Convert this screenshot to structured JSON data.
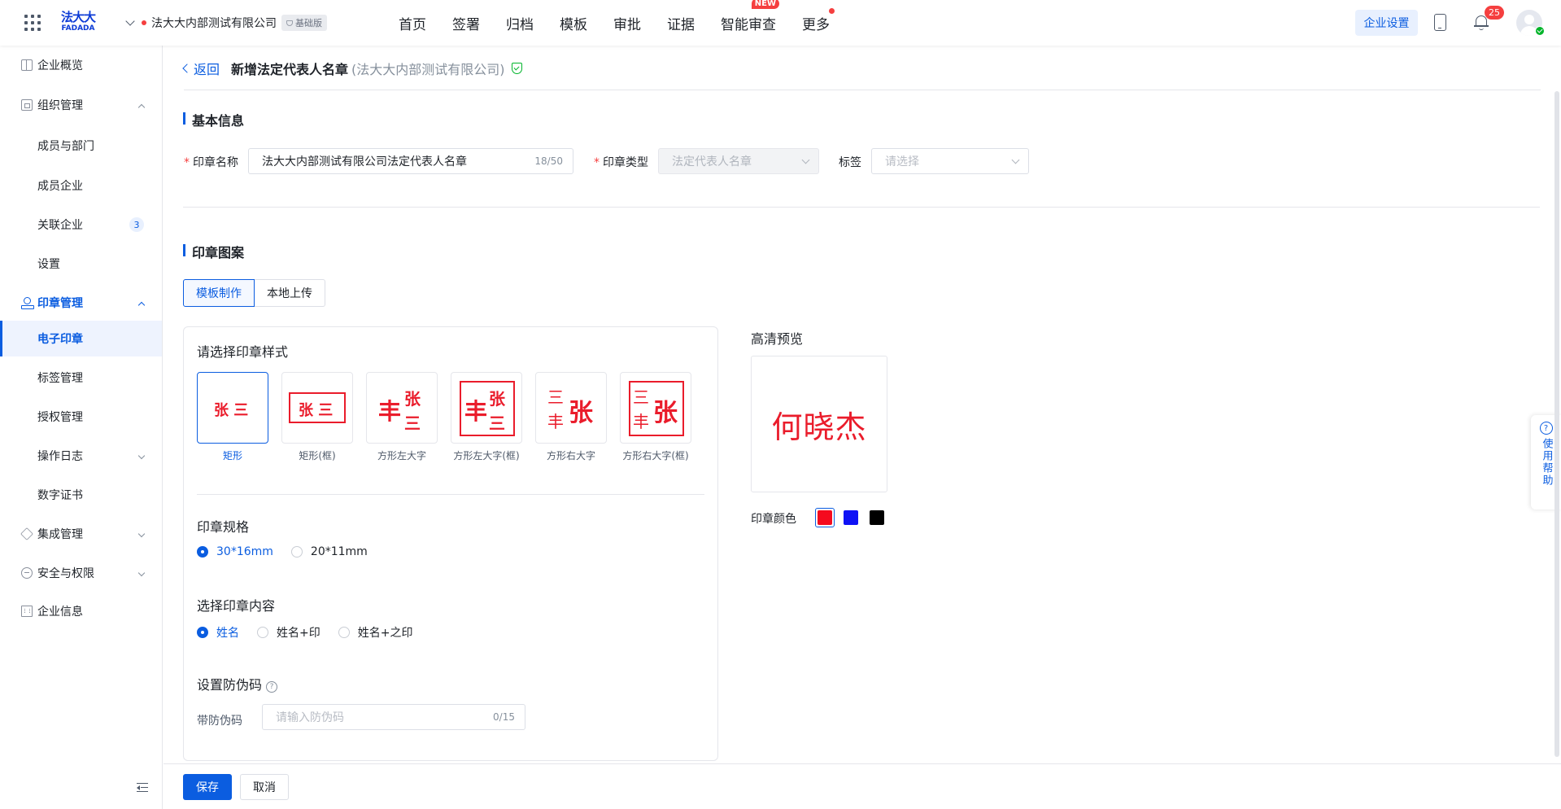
{
  "topbar": {
    "logo_cn": "法大大",
    "logo_en": "FADADA",
    "company_name": "法大大内部测试有限公司",
    "edition": "基础版",
    "nav": [
      {
        "label": "首页"
      },
      {
        "label": "签署"
      },
      {
        "label": "归档"
      },
      {
        "label": "模板"
      },
      {
        "label": "审批"
      },
      {
        "label": "证据"
      },
      {
        "label": "智能审查",
        "badge": "NEW"
      },
      {
        "label": "更多",
        "dot": true
      }
    ],
    "corp_settings": "企业设置",
    "notification_count": "25"
  },
  "sidebar": {
    "items": [
      {
        "label": "企业概览",
        "icon": "grid-icon"
      },
      {
        "label": "组织管理",
        "icon": "org-icon",
        "expanded": true
      },
      {
        "label": "成员与部门"
      },
      {
        "label": "成员企业"
      },
      {
        "label": "关联企业",
        "badge": "3"
      },
      {
        "label": "设置"
      },
      {
        "label": "印章管理",
        "icon": "seal-icon",
        "expanded": true
      },
      {
        "label": "电子印章",
        "active": true
      },
      {
        "label": "标签管理"
      },
      {
        "label": "授权管理"
      },
      {
        "label": "操作日志",
        "expandable": true
      },
      {
        "label": "数字证书"
      },
      {
        "label": "集成管理",
        "icon": "layers-icon",
        "expandable": true
      },
      {
        "label": "安全与权限",
        "icon": "shield-icon",
        "expandable": true
      },
      {
        "label": "企业信息",
        "icon": "building-icon"
      }
    ]
  },
  "page": {
    "back": "返回",
    "title": "新增法定代表人名章",
    "subtitle": "(法大大内部测试有限公司)"
  },
  "basic_info": {
    "section_title": "基本信息",
    "seal_name_label": "印章名称",
    "seal_name_value": "法大大内部测试有限公司法定代表人名章",
    "seal_name_count": "18/50",
    "seal_type_label": "印章类型",
    "seal_type_value": "法定代表人名章",
    "tag_label": "标签",
    "tag_placeholder": "请选择"
  },
  "seal_design": {
    "section_title": "印章图案",
    "tabs": [
      "模板制作",
      "本地上传"
    ],
    "style_title": "请选择印章样式",
    "styles": [
      {
        "label": "矩形",
        "selected": true
      },
      {
        "label": "矩形(框)"
      },
      {
        "label": "方形左大字"
      },
      {
        "label": "方形左大字(框)"
      },
      {
        "label": "方形右大字"
      },
      {
        "label": "方形右大字(框)"
      }
    ],
    "sample": {
      "big": "丰",
      "chars": [
        "张",
        "三"
      ],
      "rect_text": "张 三"
    },
    "spec_title": "印章规格",
    "specs": [
      {
        "label": "30*16mm",
        "selected": true
      },
      {
        "label": "20*11mm"
      }
    ],
    "content_title": "选择印章内容",
    "contents": [
      {
        "label": "姓名",
        "selected": true
      },
      {
        "label": "姓名+印"
      },
      {
        "label": "姓名+之印"
      }
    ],
    "anticounterfeit_title": "设置防伪码",
    "anticounterfeit_label": "带防伪码",
    "anticounterfeit_placeholder": "请输入防伪码",
    "anticounterfeit_count": "0/15"
  },
  "preview": {
    "title": "高清预览",
    "text": "何晓杰",
    "color_label": "印章颜色",
    "colors": [
      "#f50a1e",
      "#0f12f5",
      "#000000"
    ],
    "selected_color": "#f50a1e"
  },
  "help": {
    "label": "使用帮助",
    "icon_text": "?"
  },
  "footer": {
    "save": "保存",
    "cancel": "取消"
  }
}
